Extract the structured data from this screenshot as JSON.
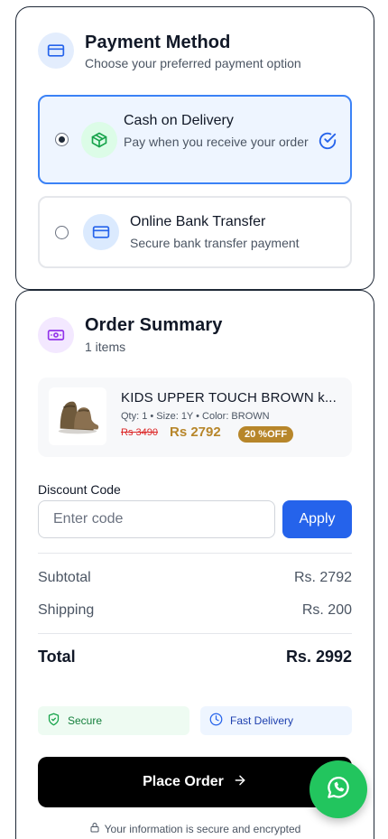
{
  "payment": {
    "title": "Payment Method",
    "subtitle": "Choose your preferred payment option",
    "header_icon": "credit-card-icon",
    "options": [
      {
        "title": "Cash on Delivery",
        "subtitle": "Pay when you receive your order",
        "icon": "package-icon",
        "selected": true
      },
      {
        "title": "Online Bank Transfer",
        "subtitle": "Secure bank transfer payment",
        "icon": "credit-card-icon",
        "selected": false
      }
    ]
  },
  "summary": {
    "title": "Order Summary",
    "item_count": "1 items",
    "header_icon": "banknote-icon",
    "product": {
      "name": "KIDS UPPER TOUCH BROWN k...",
      "meta": "Qty: 1 • Size: 1Y • Color: BROWN",
      "old_price": "Rs 3490",
      "new_price": "Rs 2792",
      "discount_badge": "20 %OFF"
    },
    "discount": {
      "label": "Discount Code",
      "placeholder": "Enter code",
      "apply_label": "Apply"
    },
    "subtotal_label": "Subtotal",
    "subtotal_value": "Rs. 2792",
    "shipping_label": "Shipping",
    "shipping_value": "Rs. 200",
    "total_label": "Total",
    "total_value": "Rs. 2992",
    "badges": {
      "secure": "Secure",
      "fast_delivery": "Fast Delivery"
    },
    "place_order_label": "Place Order",
    "secure_note": "Your information is secure and encrypted"
  },
  "fab": {
    "icon": "whatsapp-icon"
  },
  "colors": {
    "accent_blue": "#2563eb",
    "price_gold": "#b7862a",
    "whatsapp_green": "#22c55e"
  }
}
